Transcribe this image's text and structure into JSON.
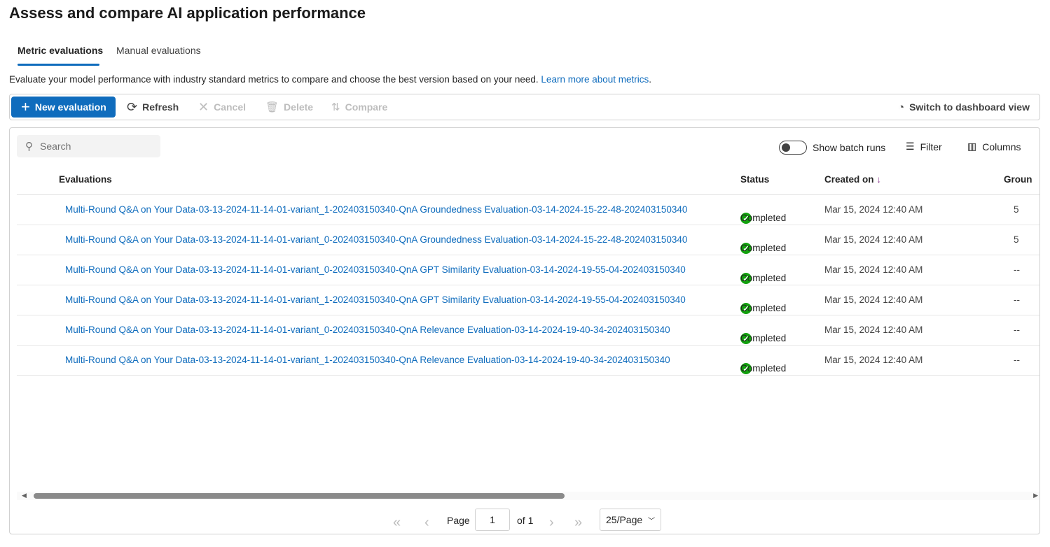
{
  "title": "Assess and compare AI application performance",
  "tabs": [
    {
      "label": "Metric evaluations",
      "active": true
    },
    {
      "label": "Manual evaluations",
      "active": false
    }
  ],
  "description": {
    "text": "Evaluate your model performance with industry standard metrics to compare and choose the best version based on your need. ",
    "link": "Learn more about metrics",
    "end": "."
  },
  "toolbar": {
    "new": "New evaluation",
    "refresh": "Refresh",
    "cancel": "Cancel",
    "delete": "Delete",
    "compare": "Compare",
    "dashboard": "Switch to dashboard view"
  },
  "table_tools": {
    "search_placeholder": "Search",
    "batch_toggle": "Show batch runs",
    "batch_toggle_on": false,
    "filter": "Filter",
    "columns": "Columns"
  },
  "columns": {
    "evaluations": "Evaluations",
    "status": "Status",
    "created": "Created on",
    "created_sort": "↓",
    "group": "Groun"
  },
  "rows": [
    {
      "name": "Multi-Round Q&A on Your Data-03-13-2024-11-14-01-variant_1-202403150340-QnA Groundedness Evaluation-03-14-2024-15-22-48-202403150340",
      "status": "Completed",
      "created": "Mar 15, 2024 12:40 AM",
      "group": "5"
    },
    {
      "name": "Multi-Round Q&A on Your Data-03-13-2024-11-14-01-variant_0-202403150340-QnA Groundedness Evaluation-03-14-2024-15-22-48-202403150340",
      "status": "Completed",
      "created": "Mar 15, 2024 12:40 AM",
      "group": "5"
    },
    {
      "name": "Multi-Round Q&A on Your Data-03-13-2024-11-14-01-variant_0-202403150340-QnA GPT Similarity Evaluation-03-14-2024-19-55-04-202403150340",
      "status": "Completed",
      "created": "Mar 15, 2024 12:40 AM",
      "group": "--"
    },
    {
      "name": "Multi-Round Q&A on Your Data-03-13-2024-11-14-01-variant_1-202403150340-QnA GPT Similarity Evaluation-03-14-2024-19-55-04-202403150340",
      "status": "Completed",
      "created": "Mar 15, 2024 12:40 AM",
      "group": "--"
    },
    {
      "name": "Multi-Round Q&A on Your Data-03-13-2024-11-14-01-variant_0-202403150340-QnA Relevance Evaluation-03-14-2024-19-40-34-202403150340",
      "status": "Completed",
      "created": "Mar 15, 2024 12:40 AM",
      "group": "--"
    },
    {
      "name": "Multi-Round Q&A on Your Data-03-13-2024-11-14-01-variant_1-202403150340-QnA Relevance Evaluation-03-14-2024-19-40-34-202403150340",
      "status": "Completed",
      "created": "Mar 15, 2024 12:40 AM",
      "group": "--"
    }
  ],
  "pagination": {
    "page_label": "Page",
    "page": "1",
    "of": "of 1",
    "per_page": "25/Page"
  },
  "colors": {
    "accent": "#0f6cbd",
    "success": "#13a10e"
  }
}
